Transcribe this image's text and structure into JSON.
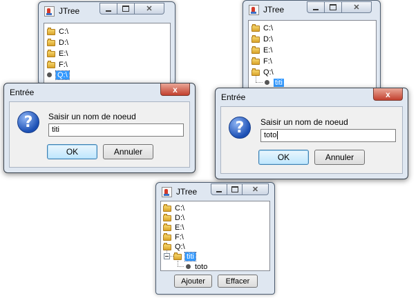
{
  "windows": [
    {
      "title": "JTree",
      "tree": [
        {
          "label": "C:\\",
          "icon": "folder-icon"
        },
        {
          "label": "D:\\",
          "icon": "folder-icon"
        },
        {
          "label": "E:\\",
          "icon": "folder-icon"
        },
        {
          "label": "F:\\",
          "icon": "folder-icon"
        },
        {
          "label": "Q:\\",
          "icon": "leaf-node-icon",
          "selected": true
        }
      ],
      "dialog": {
        "title": "Entrée",
        "close_label": "x",
        "message": "Saisir un nom de noeud",
        "input_value": "titi",
        "ok_label": "OK",
        "cancel_label": "Annuler"
      }
    },
    {
      "title": "JTree",
      "tree": [
        {
          "label": "C:\\",
          "icon": "folder-icon"
        },
        {
          "label": "D:\\",
          "icon": "folder-icon"
        },
        {
          "label": "E:\\",
          "icon": "folder-icon"
        },
        {
          "label": "F:\\",
          "icon": "folder-icon"
        },
        {
          "label": "Q:\\",
          "icon": "folder-icon"
        },
        {
          "label": "titi",
          "icon": "leaf-node-icon",
          "selected": true
        }
      ],
      "dialog": {
        "title": "Entrée",
        "close_label": "x",
        "message": "Saisir un nom de noeud",
        "input_value": "toto",
        "ok_label": "OK",
        "cancel_label": "Annuler"
      }
    },
    {
      "title": "JTree",
      "tree": [
        {
          "label": "C:\\",
          "icon": "folder-icon"
        },
        {
          "label": "D:\\",
          "icon": "folder-icon"
        },
        {
          "label": "E:\\",
          "icon": "folder-icon"
        },
        {
          "label": "F:\\",
          "icon": "folder-icon"
        },
        {
          "label": "Q:\\",
          "icon": "folder-icon"
        },
        {
          "label": "titi",
          "icon": "folder-icon",
          "selected": true,
          "expanded": true
        },
        {
          "label": "toto",
          "icon": "leaf-node-icon"
        }
      ],
      "buttons": {
        "add_label": "Ajouter",
        "delete_label": "Effacer"
      }
    }
  ],
  "colors": {
    "selection": "#3399ff",
    "close_button": "#c74536",
    "frame": "#dfe7f1"
  }
}
